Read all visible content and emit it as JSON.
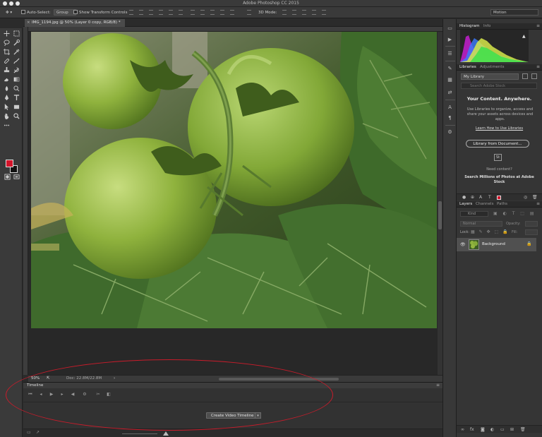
{
  "window": {
    "title": "Adobe Photoshop CC 2015"
  },
  "options_bar": {
    "auto_select_label": "Auto-Select:",
    "auto_select_value": "Group",
    "transform_controls_label": "Show Transform Controls",
    "mode_3d_label": "3D Mode:",
    "workspace_value": "Motion"
  },
  "document": {
    "tab_title": "IMG_1194.jpg @ 50% (Layer 0 copy, RGB/8) *",
    "close_glyph": "×",
    "zoom": "50%",
    "doc_size": "Doc: 22.8M/22.8M"
  },
  "colors": {
    "foreground": "#d4142a",
    "background": "#111111",
    "annotation_ellipse": "#c91c2b"
  },
  "timeline": {
    "title": "Timeline",
    "controls": [
      "first-frame-icon",
      "previous-frame-icon",
      "play-icon",
      "next-frame-icon",
      "audio-icon",
      "settings-icon",
      "split-icon",
      "transition-icon"
    ],
    "create_button": "Create Video Timeline",
    "create_dropdown": "▾"
  },
  "histogram_panel": {
    "tabs": [
      "Histogram",
      "Info"
    ],
    "warning_glyph": "▲"
  },
  "libraries_panel": {
    "tabs": [
      "Libraries",
      "Adjustments"
    ],
    "library_select": "My Library",
    "search_placeholder": "Search Adobe Stock",
    "heading": "Your Content. Anywhere.",
    "description": "Use Libraries to organize, access and share your assets across devices and apps.",
    "learn_link": "Learn How to Use Libraries",
    "from_document_button": "Library from Document...",
    "stock_badge": "St",
    "question": "Need content?",
    "stock_cta": "Search Millions of Photos at Adobe Stock"
  },
  "layers_panel": {
    "tabs": [
      "Layers",
      "Channels",
      "Paths"
    ],
    "search_placeholder": "Kind",
    "blend_mode": "Normal",
    "opacity_label": "Opacity:",
    "lock_label": "Lock:",
    "fill_label": "Fill:",
    "layers": [
      {
        "name": "Background",
        "visible": true,
        "locked": true
      }
    ]
  }
}
